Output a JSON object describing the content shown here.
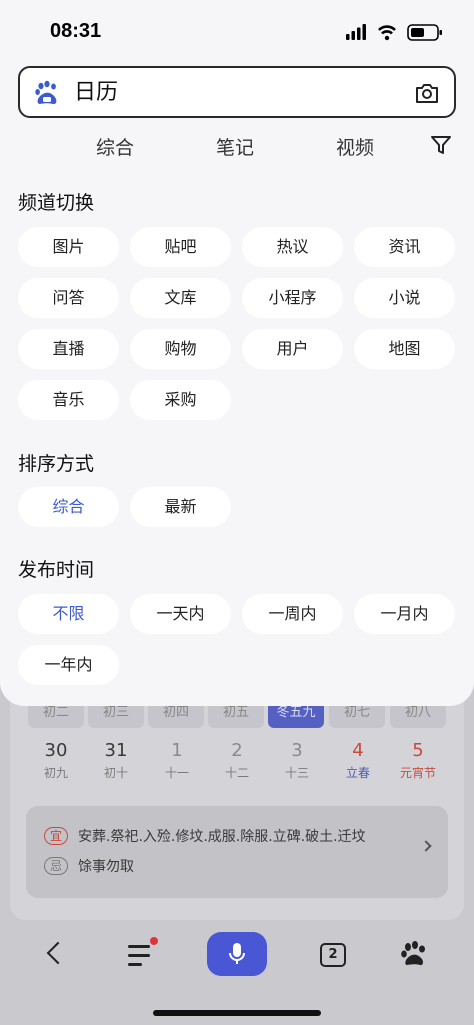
{
  "status_bar": {
    "time": "08:31"
  },
  "search": {
    "query": "日历"
  },
  "top_tabs": [
    "综合",
    "笔记",
    "视频"
  ],
  "channel": {
    "title": "频道切换",
    "items": [
      "图片",
      "贴吧",
      "热议",
      "资讯",
      "问答",
      "文库",
      "小程序",
      "小说",
      "直播",
      "购物",
      "用户",
      "地图",
      "音乐",
      "采购"
    ]
  },
  "sort": {
    "title": "排序方式",
    "items": [
      "综合",
      "最新"
    ],
    "selected": "综合"
  },
  "publish_time": {
    "title": "发布时间",
    "items": [
      "不限",
      "一天内",
      "一周内",
      "一月内",
      "一年内"
    ],
    "selected": "不限"
  },
  "calendar": {
    "week_labels": [
      "初二",
      "初三",
      "初四",
      "初五",
      "冬五九",
      "初七",
      "初八"
    ],
    "days": [
      {
        "num": "30",
        "sub": "初九"
      },
      {
        "num": "31",
        "sub": "初十"
      },
      {
        "num": "1",
        "sub": "十一"
      },
      {
        "num": "2",
        "sub": "十二"
      },
      {
        "num": "3",
        "sub": "十三"
      },
      {
        "num": "4",
        "sub": "立春"
      },
      {
        "num": "5",
        "sub": "元宵节"
      }
    ],
    "yi_label": "宜",
    "yi_text": "安葬.祭祀.入殓.修坟.成服.除服.立碑.破土.迁坟",
    "ji_label": "忌",
    "ji_text": "馀事勿取"
  },
  "bottom_nav": {
    "tab_count": "2"
  },
  "colors": {
    "accent": "#3d5bd1",
    "voice_button": "#4a57d4",
    "festival_red": "#c84a3f"
  }
}
